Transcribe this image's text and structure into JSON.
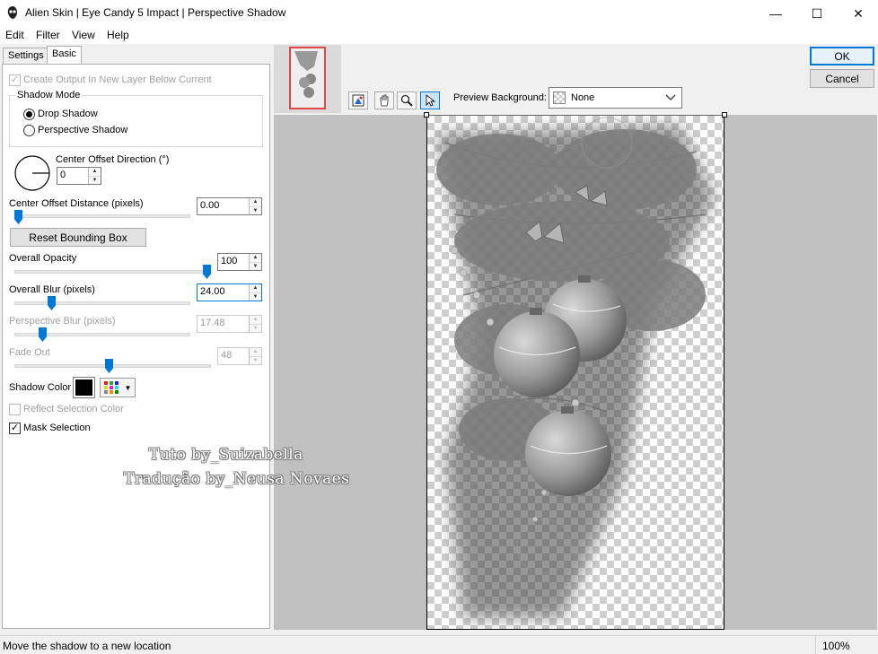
{
  "window": {
    "title": "Alien Skin | Eye Candy 5 Impact | Perspective Shadow",
    "minimize_glyph": "—",
    "maximize_glyph": "☐",
    "close_glyph": "✕"
  },
  "menu": [
    "Edit",
    "Filter",
    "View",
    "Help"
  ],
  "tabs": [
    {
      "label": "Settings",
      "active": false
    },
    {
      "label": "Basic",
      "active": true
    }
  ],
  "basic": {
    "create_output_label": "Create Output In New Layer Below Current",
    "shadow_mode": {
      "title": "Shadow Mode",
      "options": [
        {
          "label": "Drop Shadow",
          "selected": true
        },
        {
          "label": "Perspective Shadow",
          "selected": false
        }
      ]
    },
    "center_offset_direction": {
      "label": "Center Offset Direction (°)",
      "value": "0"
    },
    "center_offset_distance": {
      "label": "Center Offset Distance (pixels)",
      "value": "0.00",
      "slider_fraction": 0.02
    },
    "reset_button": "Reset Bounding Box",
    "overall_opacity": {
      "label": "Overall Opacity",
      "value": "100",
      "slider_fraction": 1.0
    },
    "overall_blur": {
      "label": "Overall Blur (pixels)",
      "value": "24.00",
      "slider_fraction": 0.22
    },
    "perspective_blur": {
      "label": "Perspective Blur (pixels)",
      "value": "17.48",
      "slider_fraction": 0.15,
      "disabled": true
    },
    "fade_out": {
      "label": "Fade Out",
      "value": "48",
      "slider_fraction": 0.48,
      "disabled": true
    },
    "shadow_color": {
      "label": "Shadow Color",
      "swatch": "#000000"
    },
    "reflect_selection_label": "Reflect Selection Color",
    "mask_selection_label": "Mask Selection",
    "mask_selection_checked": true
  },
  "preview": {
    "background_label": "Preview Background:",
    "background_value": "None",
    "tools": [
      "preview-toggle-icon",
      "hand-icon",
      "zoom-icon",
      "arrow-icon"
    ]
  },
  "buttons": {
    "ok": "OK",
    "cancel": "Cancel"
  },
  "watermark": {
    "line1": "Tuto by_Suizabella",
    "line2": "Tradução by_Neusa Novaes"
  },
  "status": {
    "message": "Move the shadow to a new location",
    "zoom": "100%"
  },
  "colors": {
    "accent": "#0078d7",
    "preview_bg": "#c0c0c0"
  }
}
